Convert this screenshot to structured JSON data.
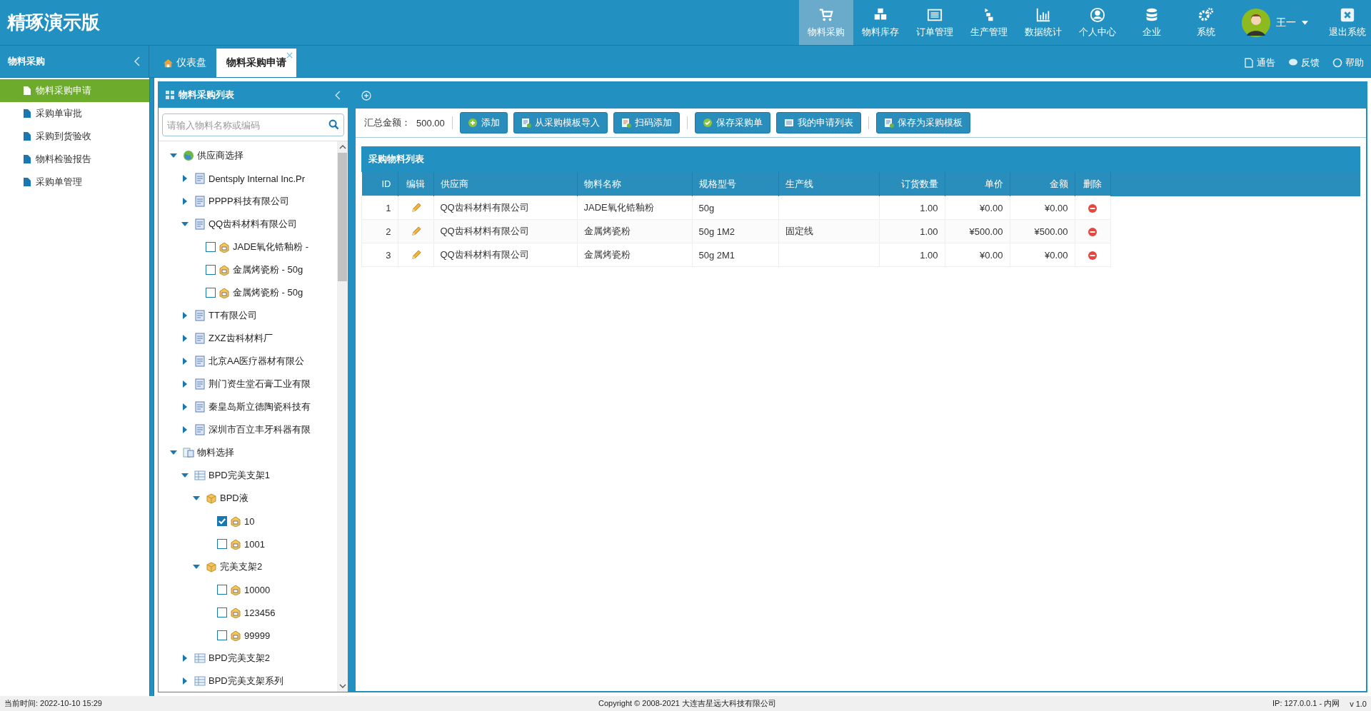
{
  "app_title": "精琢演示版",
  "nav": [
    {
      "label": "物料采购",
      "selected": true
    },
    {
      "label": "物料库存",
      "selected": false
    },
    {
      "label": "订单管理",
      "selected": false
    },
    {
      "label": "生产管理",
      "selected": false
    },
    {
      "label": "数据统计",
      "selected": false
    },
    {
      "label": "个人中心",
      "selected": false
    },
    {
      "label": "企业",
      "selected": false
    },
    {
      "label": "系统",
      "selected": false
    }
  ],
  "user": {
    "name": "王一"
  },
  "logout": "退出系统",
  "sidebar": {
    "title": "物料采购",
    "items": [
      {
        "label": "物料采购申请",
        "selected": true
      },
      {
        "label": "采购单审批",
        "selected": false
      },
      {
        "label": "采购到货验收",
        "selected": false
      },
      {
        "label": "物料检验报告",
        "selected": false
      },
      {
        "label": "采购单管理",
        "selected": false
      }
    ]
  },
  "tabs": [
    {
      "label": "仪表盘",
      "selected": false,
      "closable": false
    },
    {
      "label": "物料采购申请",
      "selected": true,
      "closable": true
    }
  ],
  "header_links": [
    "通告",
    "反馈",
    "帮助"
  ],
  "tree_panel": {
    "title": "物料采购列表",
    "search_placeholder": "请输入物料名称或编码",
    "nodes": [
      {
        "kind": "root",
        "label": "供应商选择",
        "expanded": true,
        "children": [
          {
            "kind": "supplier",
            "label": "Dentsply Internal Inc.Pr",
            "expanded": false
          },
          {
            "kind": "supplier",
            "label": "PPPP科技有限公司",
            "expanded": false
          },
          {
            "kind": "supplier",
            "label": "QQ齿科材料有限公司",
            "expanded": true,
            "children": [
              {
                "kind": "item",
                "label": "JADE氧化锆釉粉 -",
                "checked": false
              },
              {
                "kind": "item",
                "label": "金属烤瓷粉 - 50g",
                "checked": false
              },
              {
                "kind": "item",
                "label": "金属烤瓷粉 - 50g",
                "checked": false
              }
            ]
          },
          {
            "kind": "supplier",
            "label": "TT有限公司",
            "expanded": false
          },
          {
            "kind": "supplier",
            "label": "ZXZ齿科材料厂",
            "expanded": false
          },
          {
            "kind": "supplier",
            "label": "北京AA医疗器材有限公",
            "expanded": false
          },
          {
            "kind": "supplier",
            "label": "荆门资生堂石膏工业有限",
            "expanded": false
          },
          {
            "kind": "supplier",
            "label": "秦皇岛斯立德陶瓷科技有",
            "expanded": false
          },
          {
            "kind": "supplier",
            "label": "深圳市百立丰牙科器有限",
            "expanded": false
          }
        ]
      },
      {
        "kind": "catalog",
        "label": "物料选择",
        "expanded": true,
        "children": [
          {
            "kind": "category",
            "label": "BPD完美支架1",
            "expanded": true,
            "children": [
              {
                "kind": "box",
                "label": "BPD液",
                "expanded": true,
                "children": [
                  {
                    "kind": "item",
                    "label": "10",
                    "checked": true
                  },
                  {
                    "kind": "item",
                    "label": "1001",
                    "checked": false
                  }
                ]
              },
              {
                "kind": "box",
                "label": "完美支架2",
                "expanded": true,
                "children": [
                  {
                    "kind": "item",
                    "label": "10000",
                    "checked": false
                  },
                  {
                    "kind": "item",
                    "label": "123456",
                    "checked": false
                  },
                  {
                    "kind": "item",
                    "label": "99999",
                    "checked": false
                  }
                ]
              }
            ]
          },
          {
            "kind": "category",
            "label": "BPD完美支架2",
            "expanded": false
          },
          {
            "kind": "category",
            "label": "BPD完美支架系列",
            "expanded": false
          }
        ]
      }
    ]
  },
  "toolbar": {
    "total_label": "汇总金额：",
    "total_value": "500.00",
    "buttons": [
      "添加",
      "从采购模板导入",
      "扫码添加",
      "保存采购单",
      "我的申请列表",
      "保存为采购模板"
    ]
  },
  "table": {
    "title": "采购物料列表",
    "columns": [
      "ID",
      "编辑",
      "供应商",
      "物料名称",
      "规格型号",
      "生产线",
      "订货数量",
      "单价",
      "金额",
      "删除"
    ],
    "rows": [
      {
        "id": "1",
        "supplier": "QQ齿科材料有限公司",
        "material": "JADE氧化锆釉粉",
        "spec": "50g",
        "line": "",
        "qty": "1.00",
        "price": "¥0.00",
        "amount": "¥0.00"
      },
      {
        "id": "2",
        "supplier": "QQ齿科材料有限公司",
        "material": "金属烤瓷粉",
        "spec": "50g 1M2",
        "line": "固定线",
        "qty": "1.00",
        "price": "¥500.00",
        "amount": "¥500.00"
      },
      {
        "id": "3",
        "supplier": "QQ齿科材料有限公司",
        "material": "金属烤瓷粉",
        "spec": "50g 2M1",
        "line": "",
        "qty": "1.00",
        "price": "¥0.00",
        "amount": "¥0.00"
      }
    ]
  },
  "status_bar": {
    "time": "当前时间:  2022-10-10 15:29",
    "copyright": "Copyright © 2008-2021 大连吉星远大科技有限公司",
    "ip": "IP: 127.0.0.1 - 内网",
    "version": "v 1.0"
  }
}
